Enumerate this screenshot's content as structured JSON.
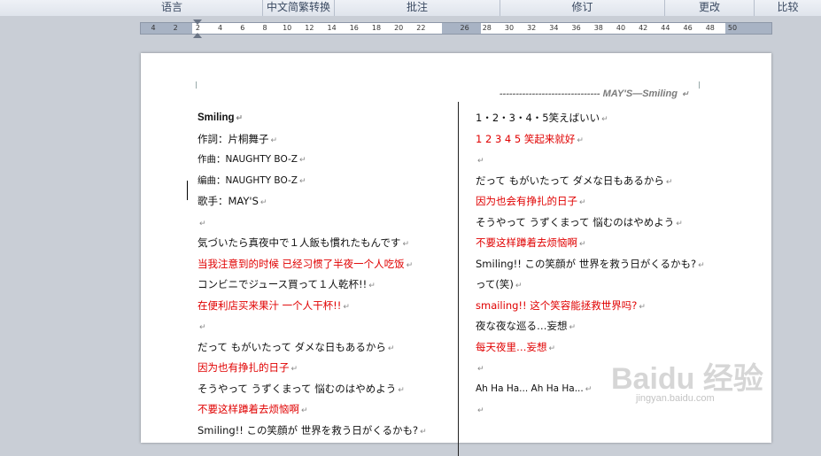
{
  "ribbon": {
    "groups": [
      "语言",
      "中文简繁转换",
      "批注",
      "修订",
      "更改",
      "比较"
    ]
  },
  "ruler": {
    "ticks": [
      "4",
      "2",
      "2",
      "4",
      "6",
      "8",
      "10",
      "12",
      "14",
      "16",
      "18",
      "20",
      "22",
      "26",
      "28",
      "30",
      "32",
      "34",
      "36",
      "38",
      "40",
      "42",
      "44",
      "46",
      "48",
      "50"
    ]
  },
  "document": {
    "header": "-------------------------------   MAY'S—Smiling",
    "left_column": [
      {
        "text": "Smiling",
        "style": "bold"
      },
      {
        "text": "作詞：片桐舞子",
        "style": ""
      },
      {
        "text": "作曲：NAUGHTY BO-Z",
        "style": "small"
      },
      {
        "text": "编曲：NAUGHTY BO-Z",
        "style": "small"
      },
      {
        "text": "歌手：MAY'S",
        "style": ""
      },
      {
        "text": "",
        "style": ""
      },
      {
        "text": "気づいたら真夜中で１人飯も慣れたもんです",
        "style": ""
      },
      {
        "text": "当我注意到的时候 已经习惯了半夜一个人吃饭",
        "style": "red"
      },
      {
        "text": "コンビニでジュース買って１人乾杯!!",
        "style": ""
      },
      {
        "text": "在便利店买来果汁 一个人干杯!!",
        "style": "red"
      },
      {
        "text": "",
        "style": ""
      },
      {
        "text": "だって もがいたって ダメな日もあるから",
        "style": ""
      },
      {
        "text": "因为也有挣扎的日子",
        "style": "red"
      },
      {
        "text": "そうやって うずくまって 悩むのはやめよう",
        "style": ""
      },
      {
        "text": "不要这样蹲着去烦恼啊",
        "style": "red"
      },
      {
        "text": "Smiling!! この笑顔が 世界を救う日がくるかも?",
        "style": ""
      }
    ],
    "right_column": [
      {
        "text": "1・2・3・4・5笑えばいい",
        "style": ""
      },
      {
        "text": "1 2 3 4 5 笑起来就好",
        "style": "red"
      },
      {
        "text": "",
        "style": ""
      },
      {
        "text": "だって もがいたって ダメな日もあるから",
        "style": ""
      },
      {
        "text": "因为也会有挣扎的日子",
        "style": "red"
      },
      {
        "text": "そうやって うずくまって 悩むのはやめよう",
        "style": ""
      },
      {
        "text": "不要这样蹲着去烦恼啊",
        "style": "red"
      },
      {
        "text": "Smiling!! この笑顔が 世界を救う日がくるかも?",
        "style": ""
      },
      {
        "text": "って(笑)",
        "style": ""
      },
      {
        "text": "smailing!! 这个笑容能拯救世界吗?",
        "style": "red"
      },
      {
        "text": "夜な夜な巡る…妄想",
        "style": ""
      },
      {
        "text": "每天夜里…妄想",
        "style": "red"
      },
      {
        "text": "",
        "style": ""
      },
      {
        "text": "Ah Ha Ha... Ah Ha Ha...",
        "style": "small"
      },
      {
        "text": "",
        "style": ""
      }
    ],
    "paragraph_mark": "↵"
  },
  "watermark": {
    "logo": "Baidu 经验",
    "url": "jingyan.baidu.com"
  }
}
